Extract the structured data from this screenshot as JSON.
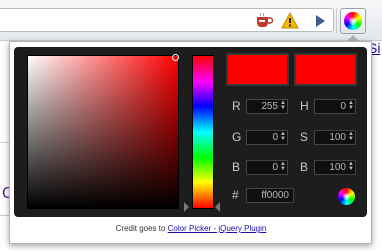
{
  "browser": {
    "extensions": [
      {
        "icon": "coffee-cup-icon"
      },
      {
        "icon": "warning-icon"
      },
      {
        "icon": "play-icon"
      },
      {
        "icon": "color-wheel-icon"
      }
    ],
    "right_link_text": "Si",
    "left_link_text": "C"
  },
  "picker": {
    "swatch_new_color": "#ff0000",
    "swatch_current_color": "#ff0000",
    "fields": {
      "r": {
        "label": "R",
        "value": "255"
      },
      "g": {
        "label": "G",
        "value": "0"
      },
      "b": {
        "label": "B",
        "value": "0"
      },
      "h": {
        "label": "H",
        "value": "0"
      },
      "s": {
        "label": "S",
        "value": "100"
      },
      "bv": {
        "label": "B",
        "value": "100"
      }
    },
    "hex": {
      "label": "#",
      "value": "ff0000"
    }
  },
  "credit": {
    "prefix": "Credit goes to ",
    "link_text": "Color Picker - jQuery Plugin"
  }
}
